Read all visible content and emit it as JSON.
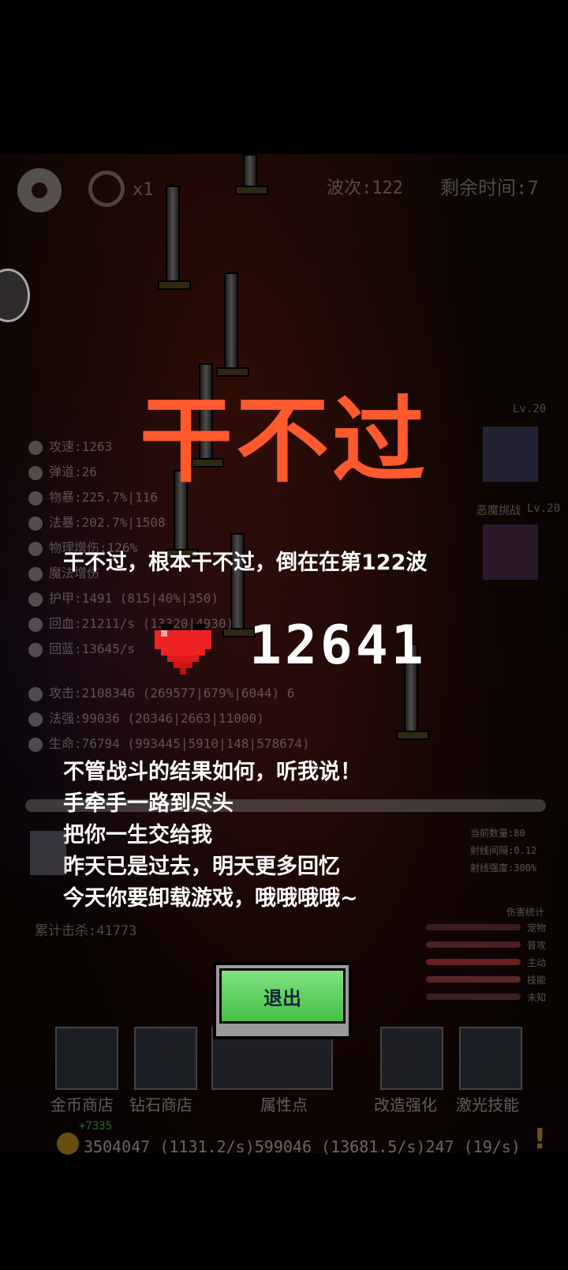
{
  "hud": {
    "wave": "波次:122",
    "time_left": "剩余时间:7",
    "speed": "x1"
  },
  "stats": [
    "攻速:1263",
    "弹道:26",
    "物暴:225.7%|116",
    "法暴:202.7%|1508",
    "物理增伤:126%",
    "魔法增伤",
    "护甲:1491 (815|40%|350)",
    "回血:21211/s (13320|4930)",
    "回蓝:13645/s",
    "攻击:2108346 (269577|679%|6044) 6",
    "法强:99036 (20346|2663|11000)",
    "生命:76794 (993445|5910|148|578674)"
  ],
  "pets": [
    {
      "level": "Lv.20"
    },
    {
      "name": "恶魔挑战",
      "level": "Lv.20"
    }
  ],
  "result": {
    "title": "干不过",
    "subtitle": "干不过，根本干不过，倒在在第122波",
    "hearts": "12641"
  },
  "lyrics": [
    "不管战斗的结果如何，听我说！",
    "手牵手一路到尽头",
    "把你一生交给我",
    "昨天已是过去，明天更多回忆",
    "今天你要卸载游戏，哦哦哦哦~"
  ],
  "laser": {
    "count": "当前数量:80",
    "interval": "射线间隔:0.12",
    "strength": "射线强度:300%"
  },
  "damage_stats": {
    "title": "伤害统计",
    "labels": [
      "宠物",
      "普攻",
      "主动",
      "技能",
      "未知"
    ],
    "colors": [
      "#5a2a2a",
      "#6a2a2a",
      "#8a2a2a",
      "#7a3030",
      "#5a3030"
    ]
  },
  "kills": "累计击杀:41773",
  "exit_button": "退出",
  "shops": [
    "金币商店",
    "钻石商店",
    "属性点",
    "改造强化",
    "激光技能"
  ],
  "resources": {
    "gain": "+7335",
    "text": "3504047 (1131.2/s)599046 (13681.5/s)247 (19/s)"
  }
}
